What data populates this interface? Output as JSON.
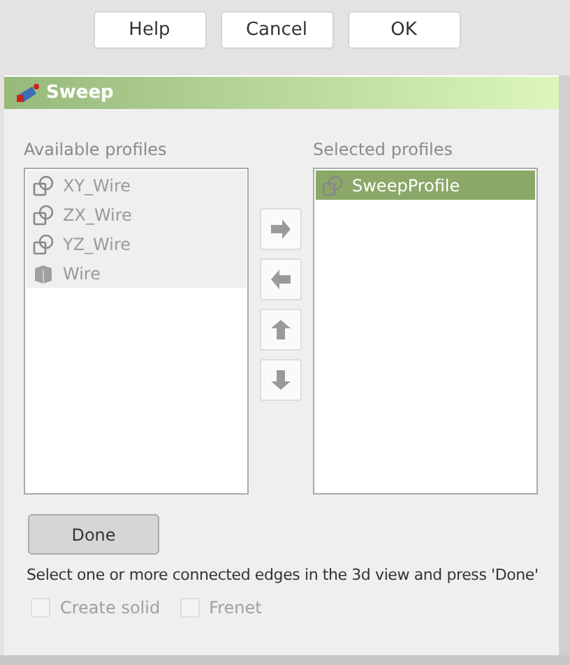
{
  "dialog_buttons": [
    {
      "label": "Help"
    },
    {
      "label": "Cancel"
    },
    {
      "label": "OK"
    }
  ],
  "panel": {
    "title": "Sweep",
    "available": {
      "label": "Available profiles",
      "items": [
        {
          "label": "XY_Wire",
          "kind": "wire",
          "disabled": true
        },
        {
          "label": "ZX_Wire",
          "kind": "wire",
          "disabled": true
        },
        {
          "label": "YZ_Wire",
          "kind": "wire",
          "disabled": true
        },
        {
          "label": "Wire",
          "kind": "solid",
          "disabled": true
        }
      ]
    },
    "move_buttons": [
      {
        "kind": "right"
      },
      {
        "kind": "left"
      },
      {
        "kind": "up"
      },
      {
        "kind": "down"
      }
    ],
    "selected": {
      "label": "Selected profiles",
      "items": [
        {
          "label": "SweepProfile",
          "kind": "wire",
          "selected": true
        }
      ]
    },
    "done_button": "Done",
    "hint": "Select one or more connected edges in the 3d view and press 'Done'",
    "options": [
      {
        "label": "Create solid",
        "checked": false,
        "disabled": true
      },
      {
        "label": "Frenet",
        "checked": false,
        "disabled": true
      }
    ]
  }
}
